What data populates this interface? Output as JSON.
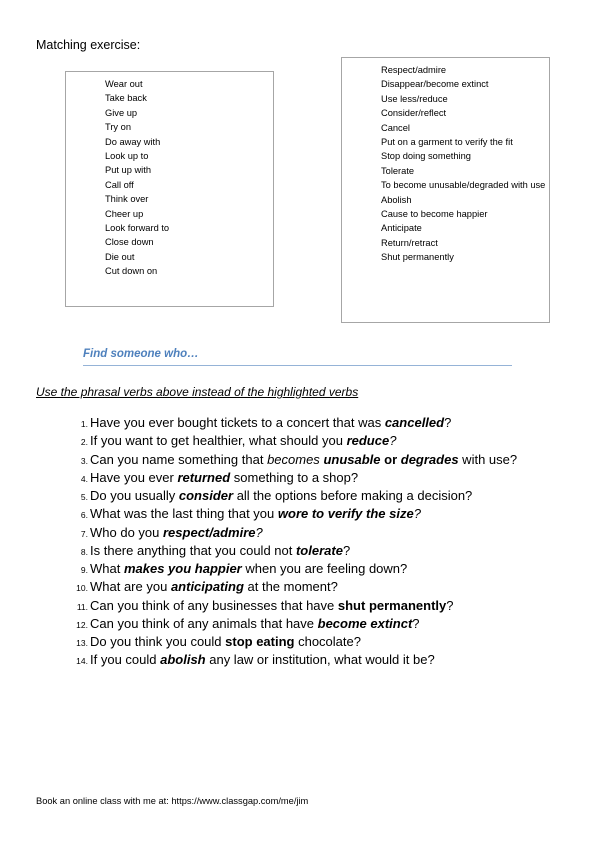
{
  "title": "Matching exercise:",
  "phrasal_verbs": [
    "Wear out",
    "Take back",
    "Give up",
    "Try on",
    "Do away with",
    "Look up to",
    "Put up with",
    "Call off",
    "Think over",
    "Cheer up",
    "Look forward to",
    "Close down",
    "Die out",
    "Cut down on"
  ],
  "definitions": [
    "Respect/admire",
    "Disappear/become extinct",
    "Use less/reduce",
    "Consider/reflect",
    "Cancel",
    "Put on a garment to verify the fit",
    "Stop doing something",
    "Tolerate",
    "To become unusable/degraded with use",
    "Abolish",
    "Cause to become happier",
    "Anticipate",
    "Return/retract",
    "Shut permanently"
  ],
  "heading": "Find someone who…",
  "instruction": "Use the phrasal verbs above instead of the highlighted verbs",
  "questions": [
    {
      "num": "1.",
      "parts": [
        {
          "t": "Have you ever bought tickets to a concert that was ",
          "s": ""
        },
        {
          "t": "cancelled",
          "s": "bi"
        },
        {
          "t": "?",
          "s": ""
        }
      ]
    },
    {
      "num": "2.",
      "parts": [
        {
          "t": "If you want to get healthier, what should you ",
          "s": ""
        },
        {
          "t": "reduce",
          "s": "bi"
        },
        {
          "t": "?",
          "s": "i"
        }
      ]
    },
    {
      "num": "3.",
      "parts": [
        {
          "t": "Can you name something that ",
          "s": ""
        },
        {
          "t": "becomes",
          "s": "i"
        },
        {
          "t": " ",
          "s": ""
        },
        {
          "t": "unusable",
          "s": "bi"
        },
        {
          "t": " or ",
          "s": "b"
        },
        {
          "t": "degrades",
          "s": "bi"
        },
        {
          "t": " with use?",
          "s": ""
        }
      ]
    },
    {
      "num": "4.",
      "parts": [
        {
          "t": "Have you ever ",
          "s": ""
        },
        {
          "t": "returned",
          "s": "bi"
        },
        {
          "t": " something to a shop?",
          "s": ""
        }
      ]
    },
    {
      "num": "5.",
      "parts": [
        {
          "t": "Do you usually ",
          "s": ""
        },
        {
          "t": "consider",
          "s": "bi"
        },
        {
          "t": " all the options before making a decision?",
          "s": ""
        }
      ]
    },
    {
      "num": "6.",
      "parts": [
        {
          "t": "What was the last thing that you ",
          "s": ""
        },
        {
          "t": "wore to verify the size",
          "s": "bi"
        },
        {
          "t": "?",
          "s": "i"
        }
      ]
    },
    {
      "num": "7.",
      "parts": [
        {
          "t": "Who do you ",
          "s": ""
        },
        {
          "t": "respect/admire",
          "s": "bi"
        },
        {
          "t": "?",
          "s": "i"
        }
      ]
    },
    {
      "num": "8.",
      "parts": [
        {
          "t": "Is there anything that you could not ",
          "s": ""
        },
        {
          "t": "tolerate",
          "s": "bi"
        },
        {
          "t": "?",
          "s": ""
        }
      ]
    },
    {
      "num": "9.",
      "parts": [
        {
          "t": "What ",
          "s": ""
        },
        {
          "t": "makes you happier",
          "s": "bi"
        },
        {
          "t": " when you are feeling down?",
          "s": ""
        }
      ]
    },
    {
      "num": "10.",
      "parts": [
        {
          "t": "What are you ",
          "s": ""
        },
        {
          "t": "anticipating",
          "s": "bi"
        },
        {
          "t": " at the moment?",
          "s": ""
        }
      ]
    },
    {
      "num": "11.",
      "parts": [
        {
          "t": "Can you think of any businesses that have ",
          "s": ""
        },
        {
          "t": "shut permanently",
          "s": "b"
        },
        {
          "t": "?",
          "s": ""
        }
      ]
    },
    {
      "num": "12.",
      "parts": [
        {
          "t": "Can you think of any animals that have ",
          "s": ""
        },
        {
          "t": "become extinct",
          "s": "bi"
        },
        {
          "t": "?",
          "s": ""
        }
      ]
    },
    {
      "num": "13.",
      "parts": [
        {
          "t": "Do you think you could ",
          "s": ""
        },
        {
          "t": "stop eating",
          "s": "b"
        },
        {
          "t": " chocolate?",
          "s": ""
        }
      ]
    },
    {
      "num": "14.",
      "parts": [
        {
          "t": "If you could ",
          "s": ""
        },
        {
          "t": "abolish",
          "s": "bi"
        },
        {
          "t": " any law or institution, what would it be?",
          "s": ""
        }
      ]
    }
  ],
  "footer": "Book an online class with me at: https://www.classgap.com/me/jim",
  "colors": {
    "heading": "#4f81bd",
    "heading_rule": "#95b3d7",
    "box_border": "#a6a6a6"
  }
}
